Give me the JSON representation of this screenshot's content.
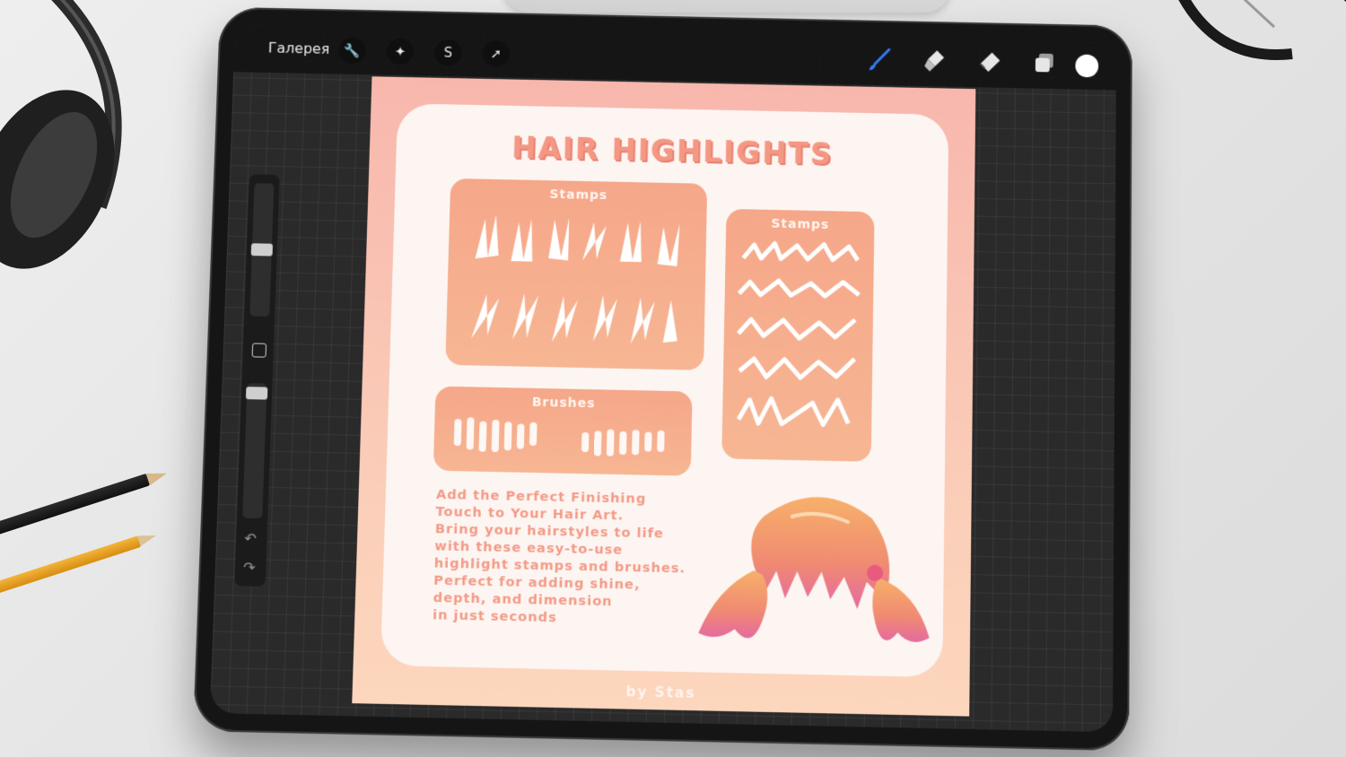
{
  "toolbar": {
    "gallery_label": "Галерея",
    "left_tools": [
      {
        "name": "wrench-icon",
        "glyph": "🔧"
      },
      {
        "name": "magic-wand-icon",
        "glyph": "✦"
      },
      {
        "name": "selection-icon",
        "glyph": "S"
      },
      {
        "name": "transform-arrow-icon",
        "glyph": "➚"
      }
    ],
    "right_tools": [
      "brush-icon",
      "smudge-icon",
      "eraser-icon",
      "layers-icon",
      "color-picker"
    ],
    "active_tool": "brush-icon",
    "accent_color": "#2f7cf6",
    "current_color": "#ffffff"
  },
  "sidebar": {
    "undo_glyph": "↶",
    "redo_glyph": "↷"
  },
  "artwork": {
    "title": "HAIR HIGHLIGHTS",
    "panel_stamps_left": "Stamps",
    "panel_stamps_right": "Stamps",
    "panel_brushes": "Brushes",
    "description_lines": [
      "Add the Perfect Finishing",
      "Touch to Your Hair Art.",
      "Bring your hairstyles to life",
      "with these easy-to-use",
      "highlight stamps and brushes.",
      "Perfect for adding shine,",
      "depth, and dimension",
      "in just seconds"
    ],
    "byline": "by Stas",
    "colors": {
      "title": "#f49884",
      "panel": "#f5a789",
      "card": "#fdf5f2"
    }
  }
}
